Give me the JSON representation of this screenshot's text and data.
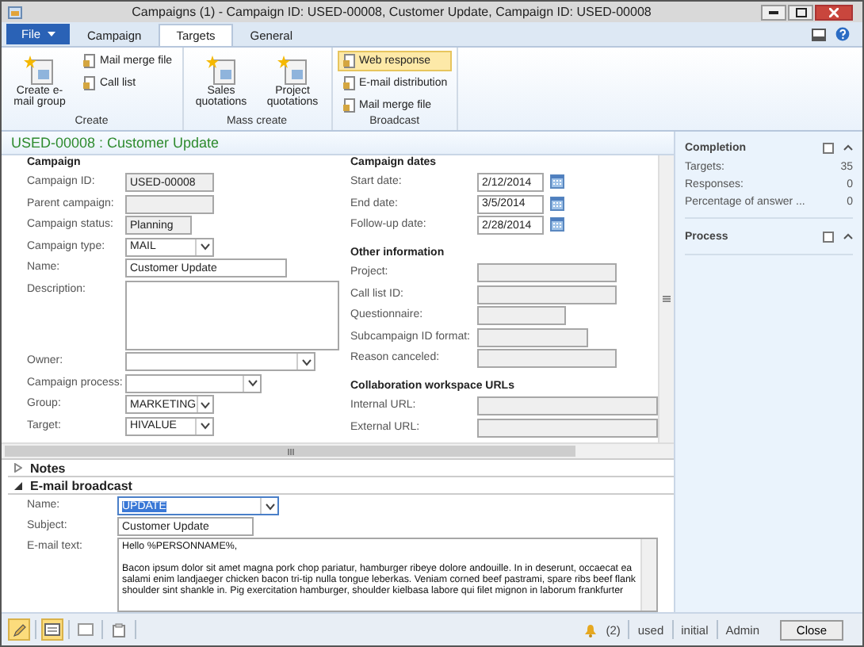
{
  "window": {
    "title": "Campaigns (1) - Campaign ID: USED-00008, Customer Update, Campaign ID: USED-00008"
  },
  "ribbon": {
    "file_label": "File",
    "tabs": [
      {
        "label": "Campaign",
        "selected": false
      },
      {
        "label": "Targets",
        "selected": true
      },
      {
        "label": "General",
        "selected": false
      }
    ],
    "groups": [
      {
        "label": "Create",
        "buttons": [
          {
            "label": "Create e-mail group",
            "kind": "large",
            "selected": false
          },
          {
            "label": "Mail merge file",
            "kind": "small",
            "selected": false
          },
          {
            "label": "Call list",
            "kind": "small",
            "selected": false
          }
        ]
      },
      {
        "label": "Mass create",
        "buttons": [
          {
            "label": "Sales quotations",
            "kind": "large",
            "selected": false
          },
          {
            "label": "Project quotations",
            "kind": "large",
            "selected": false
          }
        ]
      },
      {
        "label": "Broadcast",
        "buttons": [
          {
            "label": "Web response",
            "kind": "small",
            "selected": true
          },
          {
            "label": "E-mail distribution",
            "kind": "small",
            "selected": false
          },
          {
            "label": "Mail merge file",
            "kind": "small",
            "selected": false
          }
        ]
      }
    ]
  },
  "header": {
    "title": "USED-00008 : Customer Update"
  },
  "campaign": {
    "heading": "Campaign",
    "fields": [
      {
        "label": "Campaign ID:",
        "kind": "readonly",
        "value": "USED-00008"
      },
      {
        "label": "Parent campaign:",
        "kind": "readonly"
      },
      {
        "label": "Campaign status:",
        "kind": "readonly",
        "value": "Planning"
      },
      {
        "label": "Campaign type:",
        "kind": "combo",
        "value": "MAIL"
      },
      {
        "label": "Name:",
        "kind": "text",
        "value": "Customer Update"
      },
      {
        "label": "Description:",
        "kind": "textarea"
      },
      {
        "label": "Owner:",
        "kind": "combo"
      },
      {
        "label": "Campaign process:",
        "kind": "combo"
      },
      {
        "label": "Group:",
        "kind": "combo",
        "value": "MARKETING"
      },
      {
        "label": "Target:",
        "kind": "combo",
        "value": "HIVALUE"
      }
    ]
  },
  "dates": {
    "heading": "Campaign dates",
    "fields": [
      {
        "label": "Start date:",
        "kind": "date",
        "value": "2/12/2014"
      },
      {
        "label": "End date:",
        "kind": "date",
        "value": "3/5/2014"
      },
      {
        "label": "Follow-up date:",
        "kind": "date",
        "value": "2/28/2014"
      }
    ]
  },
  "other_information": {
    "heading": "Other information",
    "fields": [
      {
        "label": "Project:",
        "kind": "readonly"
      },
      {
        "label": "Call list ID:",
        "kind": "readonly"
      },
      {
        "label": "Questionnaire:",
        "kind": "readonly"
      },
      {
        "label": "Subcampaign ID format:",
        "kind": "readonly"
      },
      {
        "label": "Reason canceled:",
        "kind": "readonly"
      }
    ]
  },
  "collaboration": {
    "heading": "Collaboration workspace URLs",
    "fields": [
      {
        "label": "Internal URL:",
        "kind": "readonly"
      },
      {
        "label": "External URL:",
        "kind": "readonly"
      }
    ]
  },
  "fasttabs": [
    {
      "label": "Notes",
      "expanded": false
    },
    {
      "label": "E-mail broadcast",
      "expanded": true
    }
  ],
  "email": {
    "name_label": "Name:",
    "name_value": "UPDATE",
    "name_text_selected": true,
    "subject_label": "Subject:",
    "subject_value": "Customer Update",
    "text_label": "E-mail text:",
    "text_value": "Hello %PERSONNAME%,\n\nBacon ipsum dolor sit amet magna pork chop pariatur, hamburger ribeye dolore andouille. In in deserunt, occaecat ea salami enim landjaeger chicken bacon tri-tip nulla tongue leberkas. Veniam corned beef pastrami, spare ribs beef flank shoulder sint shankle in. Pig exercitation hamburger, shoulder kielbasa labore qui filet mignon in laborum frankfurter"
  },
  "factbox": [
    {
      "title": "Completion",
      "expanded": true,
      "rows": [
        {
          "label": "Targets:",
          "value": "35"
        },
        {
          "label": "Responses:",
          "value": "0"
        },
        {
          "label": "Percentage of answer ...",
          "value": "0"
        }
      ]
    },
    {
      "title": "Process",
      "expanded": true
    }
  ],
  "status_bar": {
    "tools": [
      {
        "kind": "edit",
        "on": true
      },
      {
        "kind": "form",
        "on": true
      },
      {
        "kind": "grid",
        "on": false
      },
      {
        "kind": "attach",
        "on": false
      }
    ],
    "notifications": "(2)",
    "items": [
      "used",
      "initial",
      "Admin"
    ],
    "close": "Close"
  }
}
